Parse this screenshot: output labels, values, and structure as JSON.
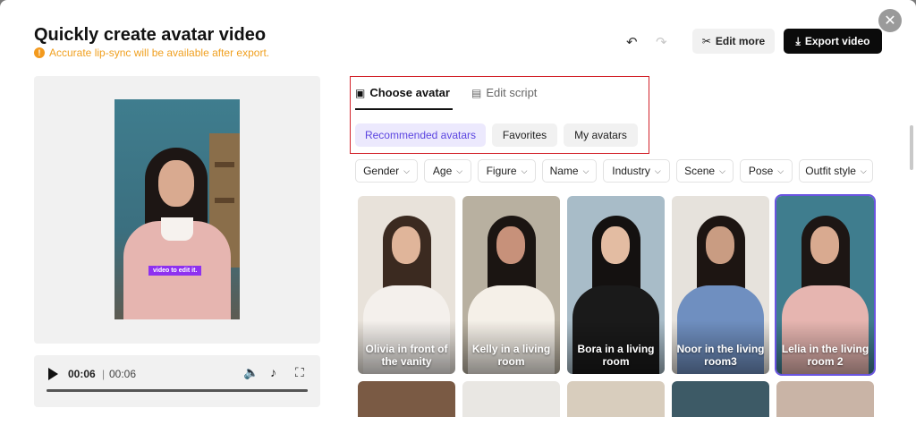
{
  "header": {
    "title": "Quickly create avatar video",
    "warning": "Accurate lip-sync will be available after export.",
    "edit_more": "Edit more",
    "export_video": "Export video"
  },
  "preview": {
    "subtitle_text": "video to edit it."
  },
  "player": {
    "current_time": "00:06",
    "separator": "|",
    "total_time": "00:06",
    "progress": 1.0
  },
  "tabs": [
    {
      "label": "Choose avatar",
      "icon": "avatar-icon",
      "active": true
    },
    {
      "label": "Edit script",
      "icon": "script-icon",
      "active": false
    }
  ],
  "categories": [
    {
      "label": "Recommended avatars",
      "active": true
    },
    {
      "label": "Favorites",
      "active": false
    },
    {
      "label": "My avatars",
      "active": false
    }
  ],
  "filters": [
    "Gender",
    "Age",
    "Figure",
    "Name",
    "Industry",
    "Scene",
    "Pose",
    "Outfit style"
  ],
  "avatars": [
    {
      "name": "Olivia in front of the vanity",
      "selected": false,
      "bg": "#e8e2da",
      "hair": "#3b2a20",
      "skin": "#e0b59a",
      "outfit": "#f4f0ec"
    },
    {
      "name": "Kelly in a living room",
      "selected": false,
      "bg": "#b8b0a0",
      "hair": "#1b1512",
      "skin": "#c7917a",
      "outfit": "#f5f0e8"
    },
    {
      "name": "Bora in a living room",
      "selected": false,
      "bg": "#a8bcc8",
      "hair": "#141110",
      "skin": "#e3bca2",
      "outfit": "#1a1a1a"
    },
    {
      "name": "Noor in the living room3",
      "selected": false,
      "bg": "#e6e2dc",
      "hair": "#1d1512",
      "skin": "#c99c82",
      "outfit": "#6f8fc0"
    },
    {
      "name": "Lelia in the living room 2",
      "selected": true,
      "bg": "#3f7d8e",
      "hair": "#1d1614",
      "skin": "#d9aa90",
      "outfit": "#e6b5b0"
    }
  ],
  "colors": {
    "accent": "#5b45e0",
    "warning": "#f39a1e",
    "highlight_box": "#d2222a"
  }
}
